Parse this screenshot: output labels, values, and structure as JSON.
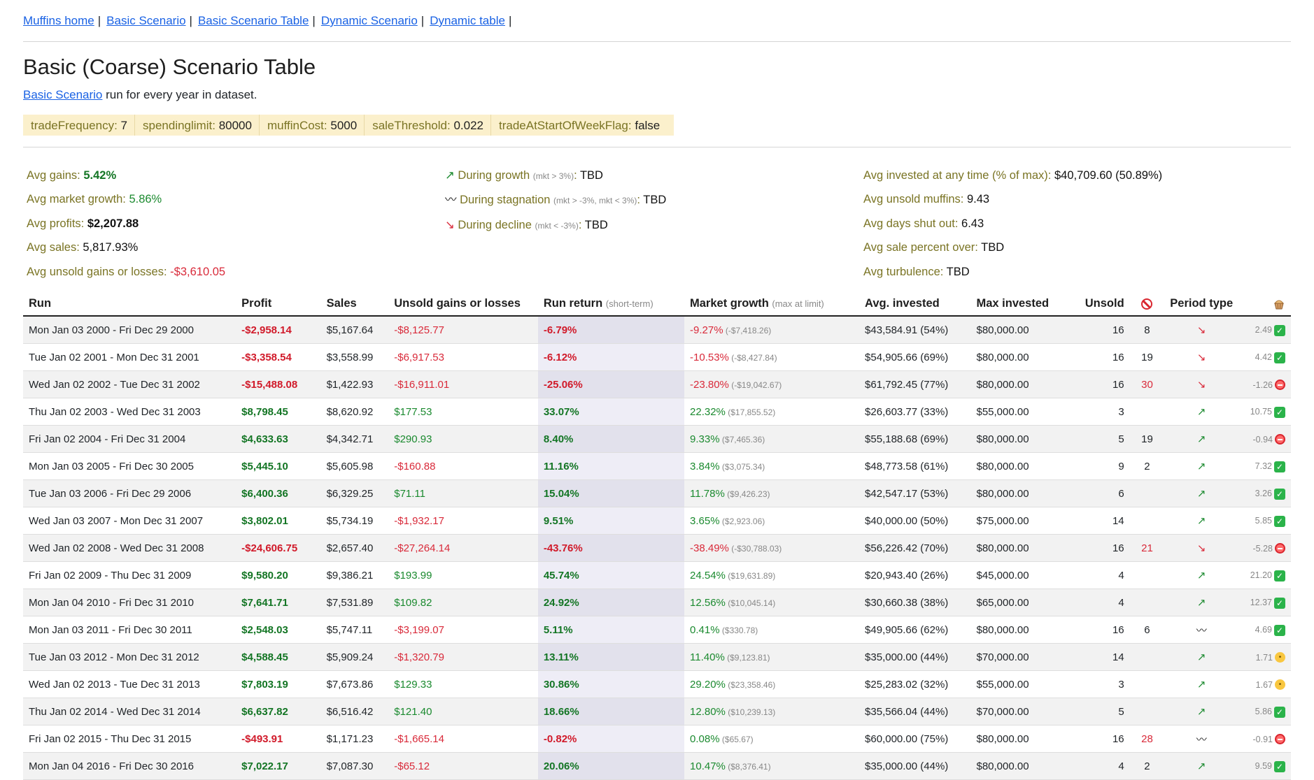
{
  "nav": [
    {
      "label": "Muffins home"
    },
    {
      "label": "Basic Scenario"
    },
    {
      "label": "Basic Scenario Table"
    },
    {
      "label": "Dynamic Scenario"
    },
    {
      "label": "Dynamic table"
    }
  ],
  "nav_sep": "|",
  "title": "Basic (Coarse) Scenario Table",
  "subtitle": {
    "link": "Basic Scenario",
    "text": " run for every year in dataset."
  },
  "params": [
    {
      "key": "tradeFrequency:",
      "value": "7"
    },
    {
      "key": "spendinglimit:",
      "value": "80000"
    },
    {
      "key": "muffinCost:",
      "value": "5000"
    },
    {
      "key": "saleThreshold:",
      "value": "0.022"
    },
    {
      "key": "tradeAtStartOfWeekFlag:",
      "value": "false"
    }
  ],
  "stats": {
    "avg_gains": {
      "label": "Avg gains:",
      "value": "5.42%"
    },
    "avg_market_growth": {
      "label": "Avg market growth:",
      "value": "5.86%"
    },
    "avg_profits": {
      "label": "Avg profits:",
      "value": "$2,207.88"
    },
    "avg_sales": {
      "label": "Avg sales:",
      "value": "5,817.93%"
    },
    "avg_unsold": {
      "label": "Avg unsold gains or losses:",
      "value": "-$3,610.05"
    },
    "growth": {
      "icon": "↗",
      "label": "During growth",
      "hint": "(mkt > 3%)",
      "value": "TBD"
    },
    "stagnation": {
      "icon": "〰",
      "label": "During stagnation",
      "hint": "(mkt > -3%, mkt < 3%)",
      "value": "TBD"
    },
    "decline": {
      "icon": "↘",
      "label": "During decline",
      "hint": "(mkt < -3%)",
      "value": "TBD"
    },
    "avg_invested": {
      "label": "Avg invested at any time (% of max):",
      "value": "$40,709.60 (50.89%)"
    },
    "avg_unsold_muffins": {
      "label": "Avg unsold muffins:",
      "value": "9.43"
    },
    "avg_days_shut": {
      "label": "Avg days shut out:",
      "value": "6.43"
    },
    "avg_sale_pct": {
      "label": "Avg sale percent over:",
      "value": "TBD"
    },
    "avg_turbulence": {
      "label": "Avg turbulence:",
      "value": "TBD"
    }
  },
  "table": {
    "headers": {
      "run": "Run",
      "profit": "Profit",
      "sales": "Sales",
      "unsold": "Unsold gains or losses",
      "run_return": "Run return",
      "run_return_hint": "(short-term)",
      "market_growth": "Market growth",
      "market_growth_hint": "(max at limit)",
      "avg_invested": "Avg. invested",
      "max_invested": "Max invested",
      "unsold_count": "Unsold",
      "shutout_icon": "prohibited-icon",
      "period": "Period type",
      "muffin_icon": "muffin-icon"
    },
    "rows": [
      {
        "run": "Mon Jan 03 2000 - Fri Dec 29 2000",
        "profit": "-$2,958.14",
        "sales": "$5,167.64",
        "unsold": "-$8,125.77",
        "ret": "-6.79%",
        "mg": "-9.27%",
        "mgv": "(-$7,418.26)",
        "avg": "$43,584.91 (54%)",
        "max": "$80,000.00",
        "uc": "16",
        "so": "8",
        "so_red": false,
        "period": "↘",
        "score": "2.49",
        "status": "ok",
        "neg": true
      },
      {
        "run": "Tue Jan 02 2001 - Mon Dec 31 2001",
        "profit": "-$3,358.54",
        "sales": "$3,558.99",
        "unsold": "-$6,917.53",
        "ret": "-6.12%",
        "mg": "-10.53%",
        "mgv": "(-$8,427.84)",
        "avg": "$54,905.66 (69%)",
        "max": "$80,000.00",
        "uc": "16",
        "so": "19",
        "so_red": false,
        "period": "↘",
        "score": "4.42",
        "status": "ok",
        "neg": true
      },
      {
        "run": "Wed Jan 02 2002 - Tue Dec 31 2002",
        "profit": "-$15,488.08",
        "sales": "$1,422.93",
        "unsold": "-$16,911.01",
        "ret": "-25.06%",
        "mg": "-23.80%",
        "mgv": "(-$19,042.67)",
        "avg": "$61,792.45 (77%)",
        "max": "$80,000.00",
        "uc": "16",
        "so": "30",
        "so_red": true,
        "period": "↘",
        "score": "-1.26",
        "status": "no",
        "neg": true
      },
      {
        "run": "Thu Jan 02 2003 - Wed Dec 31 2003",
        "profit": "$8,798.45",
        "sales": "$8,620.92",
        "unsold": "$177.53",
        "ret": "33.07%",
        "mg": "22.32%",
        "mgv": "($17,855.52)",
        "avg": "$26,603.77 (33%)",
        "max": "$55,000.00",
        "uc": "3",
        "so": "",
        "so_red": false,
        "period": "↗",
        "score": "10.75",
        "status": "ok",
        "neg": false
      },
      {
        "run": "Fri Jan 02 2004 - Fri Dec 31 2004",
        "profit": "$4,633.63",
        "sales": "$4,342.71",
        "unsold": "$290.93",
        "ret": "8.40%",
        "mg": "9.33%",
        "mgv": "($7,465.36)",
        "avg": "$55,188.68 (69%)",
        "max": "$80,000.00",
        "uc": "5",
        "so": "19",
        "so_red": false,
        "period": "↗",
        "score": "-0.94",
        "status": "no",
        "neg": false
      },
      {
        "run": "Mon Jan 03 2005 - Fri Dec 30 2005",
        "profit": "$5,445.10",
        "sales": "$5,605.98",
        "unsold": "-$160.88",
        "ret": "11.16%",
        "mg": "3.84%",
        "mgv": "($3,075.34)",
        "avg": "$48,773.58 (61%)",
        "max": "$80,000.00",
        "uc": "9",
        "so": "2",
        "so_red": false,
        "period": "↗",
        "score": "7.32",
        "status": "ok",
        "neg": false,
        "unsold_neg": true
      },
      {
        "run": "Tue Jan 03 2006 - Fri Dec 29 2006",
        "profit": "$6,400.36",
        "sales": "$6,329.25",
        "unsold": "$71.11",
        "ret": "15.04%",
        "mg": "11.78%",
        "mgv": "($9,426.23)",
        "avg": "$42,547.17 (53%)",
        "max": "$80,000.00",
        "uc": "6",
        "so": "",
        "so_red": false,
        "period": "↗",
        "score": "3.26",
        "status": "ok",
        "neg": false
      },
      {
        "run": "Wed Jan 03 2007 - Mon Dec 31 2007",
        "profit": "$3,802.01",
        "sales": "$5,734.19",
        "unsold": "-$1,932.17",
        "ret": "9.51%",
        "mg": "3.65%",
        "mgv": "($2,923.06)",
        "avg": "$40,000.00 (50%)",
        "max": "$75,000.00",
        "uc": "14",
        "so": "",
        "so_red": false,
        "period": "↗",
        "score": "5.85",
        "status": "ok",
        "neg": false,
        "unsold_neg": true
      },
      {
        "run": "Wed Jan 02 2008 - Wed Dec 31 2008",
        "profit": "-$24,606.75",
        "sales": "$2,657.40",
        "unsold": "-$27,264.14",
        "ret": "-43.76%",
        "mg": "-38.49%",
        "mgv": "(-$30,788.03)",
        "avg": "$56,226.42 (70%)",
        "max": "$80,000.00",
        "uc": "16",
        "so": "21",
        "so_red": true,
        "period": "↘",
        "score": "-5.28",
        "status": "no",
        "neg": true
      },
      {
        "run": "Fri Jan 02 2009 - Thu Dec 31 2009",
        "profit": "$9,580.20",
        "sales": "$9,386.21",
        "unsold": "$193.99",
        "ret": "45.74%",
        "mg": "24.54%",
        "mgv": "($19,631.89)",
        "avg": "$20,943.40 (26%)",
        "max": "$45,000.00",
        "uc": "4",
        "so": "",
        "so_red": false,
        "period": "↗",
        "score": "21.20",
        "status": "ok",
        "neg": false
      },
      {
        "run": "Mon Jan 04 2010 - Fri Dec 31 2010",
        "profit": "$7,641.71",
        "sales": "$7,531.89",
        "unsold": "$109.82",
        "ret": "24.92%",
        "mg": "12.56%",
        "mgv": "($10,045.14)",
        "avg": "$30,660.38 (38%)",
        "max": "$65,000.00",
        "uc": "4",
        "so": "",
        "so_red": false,
        "period": "↗",
        "score": "12.37",
        "status": "ok",
        "neg": false
      },
      {
        "run": "Mon Jan 03 2011 - Fri Dec 30 2011",
        "profit": "$2,548.03",
        "sales": "$5,747.11",
        "unsold": "-$3,199.07",
        "ret": "5.11%",
        "mg": "0.41%",
        "mgv": "($330.78)",
        "avg": "$49,905.66 (62%)",
        "max": "$80,000.00",
        "uc": "16",
        "so": "6",
        "so_red": false,
        "period": "〰",
        "score": "4.69",
        "status": "ok",
        "neg": false,
        "unsold_neg": true
      },
      {
        "run": "Tue Jan 03 2012 - Mon Dec 31 2012",
        "profit": "$4,588.45",
        "sales": "$5,909.24",
        "unsold": "-$1,320.79",
        "ret": "13.11%",
        "mg": "11.40%",
        "mgv": "($9,123.81)",
        "avg": "$35,000.00 (44%)",
        "max": "$70,000.00",
        "uc": "14",
        "so": "",
        "so_red": false,
        "period": "↗",
        "score": "1.71",
        "status": "meh",
        "neg": false,
        "unsold_neg": true
      },
      {
        "run": "Wed Jan 02 2013 - Tue Dec 31 2013",
        "profit": "$7,803.19",
        "sales": "$7,673.86",
        "unsold": "$129.33",
        "ret": "30.86%",
        "mg": "29.20%",
        "mgv": "($23,358.46)",
        "avg": "$25,283.02 (32%)",
        "max": "$55,000.00",
        "uc": "3",
        "so": "",
        "so_red": false,
        "period": "↗",
        "score": "1.67",
        "status": "meh",
        "neg": false
      },
      {
        "run": "Thu Jan 02 2014 - Wed Dec 31 2014",
        "profit": "$6,637.82",
        "sales": "$6,516.42",
        "unsold": "$121.40",
        "ret": "18.66%",
        "mg": "12.80%",
        "mgv": "($10,239.13)",
        "avg": "$35,566.04 (44%)",
        "max": "$70,000.00",
        "uc": "5",
        "so": "",
        "so_red": false,
        "period": "↗",
        "score": "5.86",
        "status": "ok",
        "neg": false
      },
      {
        "run": "Fri Jan 02 2015 - Thu Dec 31 2015",
        "profit": "-$493.91",
        "sales": "$1,171.23",
        "unsold": "-$1,665.14",
        "ret": "-0.82%",
        "mg": "0.08%",
        "mgv": "($65.67)",
        "avg": "$60,000.00 (75%)",
        "max": "$80,000.00",
        "uc": "16",
        "so": "28",
        "so_red": true,
        "period": "〰",
        "score": "-0.91",
        "status": "no",
        "neg": true,
        "mg_pos": true
      },
      {
        "run": "Mon Jan 04 2016 - Fri Dec 30 2016",
        "profit": "$7,022.17",
        "sales": "$7,087.30",
        "unsold": "-$65.12",
        "ret": "20.06%",
        "mg": "10.47%",
        "mgv": "($8,376.41)",
        "avg": "$35,000.00 (44%)",
        "max": "$80,000.00",
        "uc": "4",
        "so": "2",
        "so_red": false,
        "period": "↗",
        "score": "9.59",
        "status": "ok",
        "neg": false,
        "unsold_neg": true
      }
    ]
  },
  "colors": {
    "link": "#1a62e4",
    "positive": "#1b8a2f",
    "negative": "#d92a3a",
    "param_bg": "#fbf0cc"
  }
}
